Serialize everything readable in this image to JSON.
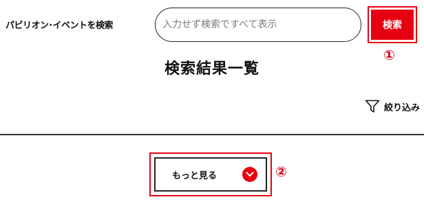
{
  "search": {
    "label": "パビリオン･イベントを検索",
    "placeholder": "入力せず検索ですべて表示",
    "value": "",
    "button_label": "検索"
  },
  "annotations": {
    "step1": "①",
    "step2": "②"
  },
  "results": {
    "title": "検索結果一覧"
  },
  "filter": {
    "label": "絞り込み",
    "icon": "filter-funnel-icon"
  },
  "more": {
    "label": "もっと見る",
    "icon": "chevron-down-icon"
  },
  "colors": {
    "accent": "#e60012",
    "text": "#111111",
    "border": "#222222"
  }
}
